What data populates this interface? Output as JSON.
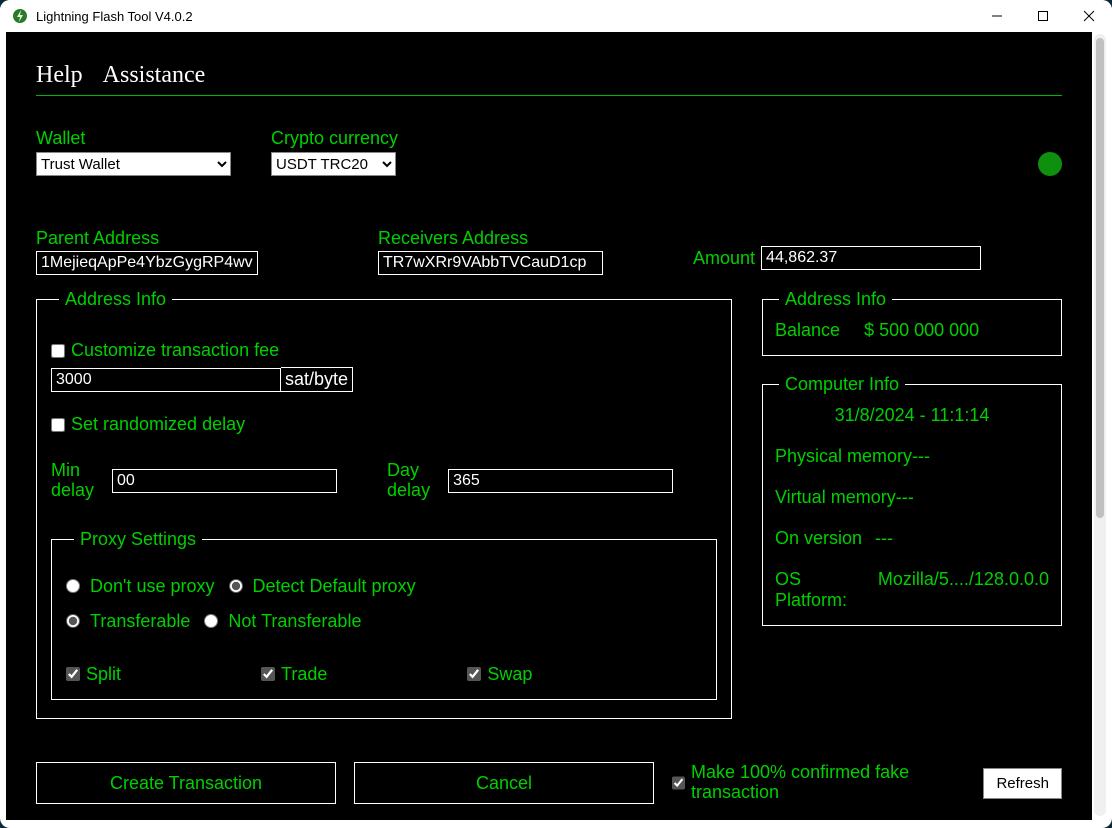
{
  "window": {
    "title": "Lightning Flash Tool V4.0.2"
  },
  "menu": {
    "help": "Help",
    "assistance": "Assistance"
  },
  "wallet": {
    "label": "Wallet",
    "value": "Trust Wallet"
  },
  "crypto": {
    "label": "Crypto currency",
    "value": "USDT TRC20"
  },
  "parent": {
    "label": "Parent Address",
    "value": "1MejieqApPe4YbzGygRP4wv"
  },
  "receiver": {
    "label": "Receivers Address",
    "value": "TR7wXRr9VAbbTVCauD1cp"
  },
  "amount": {
    "label": "Amount",
    "value": "44,862.37"
  },
  "addressInfo": {
    "legend": "Address Info",
    "customizeFee": "Customize transaction fee",
    "feeValue": "3000",
    "feeUnit": "sat/byte",
    "setRandomDelay": "Set randomized delay",
    "minDelayLabel": "Min delay",
    "minDelayValue": "00",
    "dayDelayLabel": "Day delay",
    "dayDelayValue": "365"
  },
  "proxy": {
    "legend": "Proxy Settings",
    "dontUse": "Don't use proxy",
    "detect": "Detect Default proxy",
    "transferable": "Transferable",
    "notTransferable": "Not Transferable",
    "split": "Split",
    "trade": "Trade",
    "swap": "Swap"
  },
  "balance": {
    "legend": "Address Info",
    "label": "Balance",
    "value": "$ 500 000 000"
  },
  "computer": {
    "legend": "Computer Info",
    "datetime": "31/8/2024 - 11:1:14",
    "physMemK": "Physical memory",
    "physMemV": "---",
    "virtMemK": "Virtual memory",
    "virtMemV": "---",
    "onVerK": "On version",
    "onVerV": "---",
    "osK": "OS Platform:",
    "osV": "Mozilla/5..../128.0.0.0"
  },
  "buttons": {
    "create": "Create Transaction",
    "cancel": "Cancel",
    "confirm": "Make 100% confirmed fake transaction",
    "refresh": "Refresh"
  }
}
